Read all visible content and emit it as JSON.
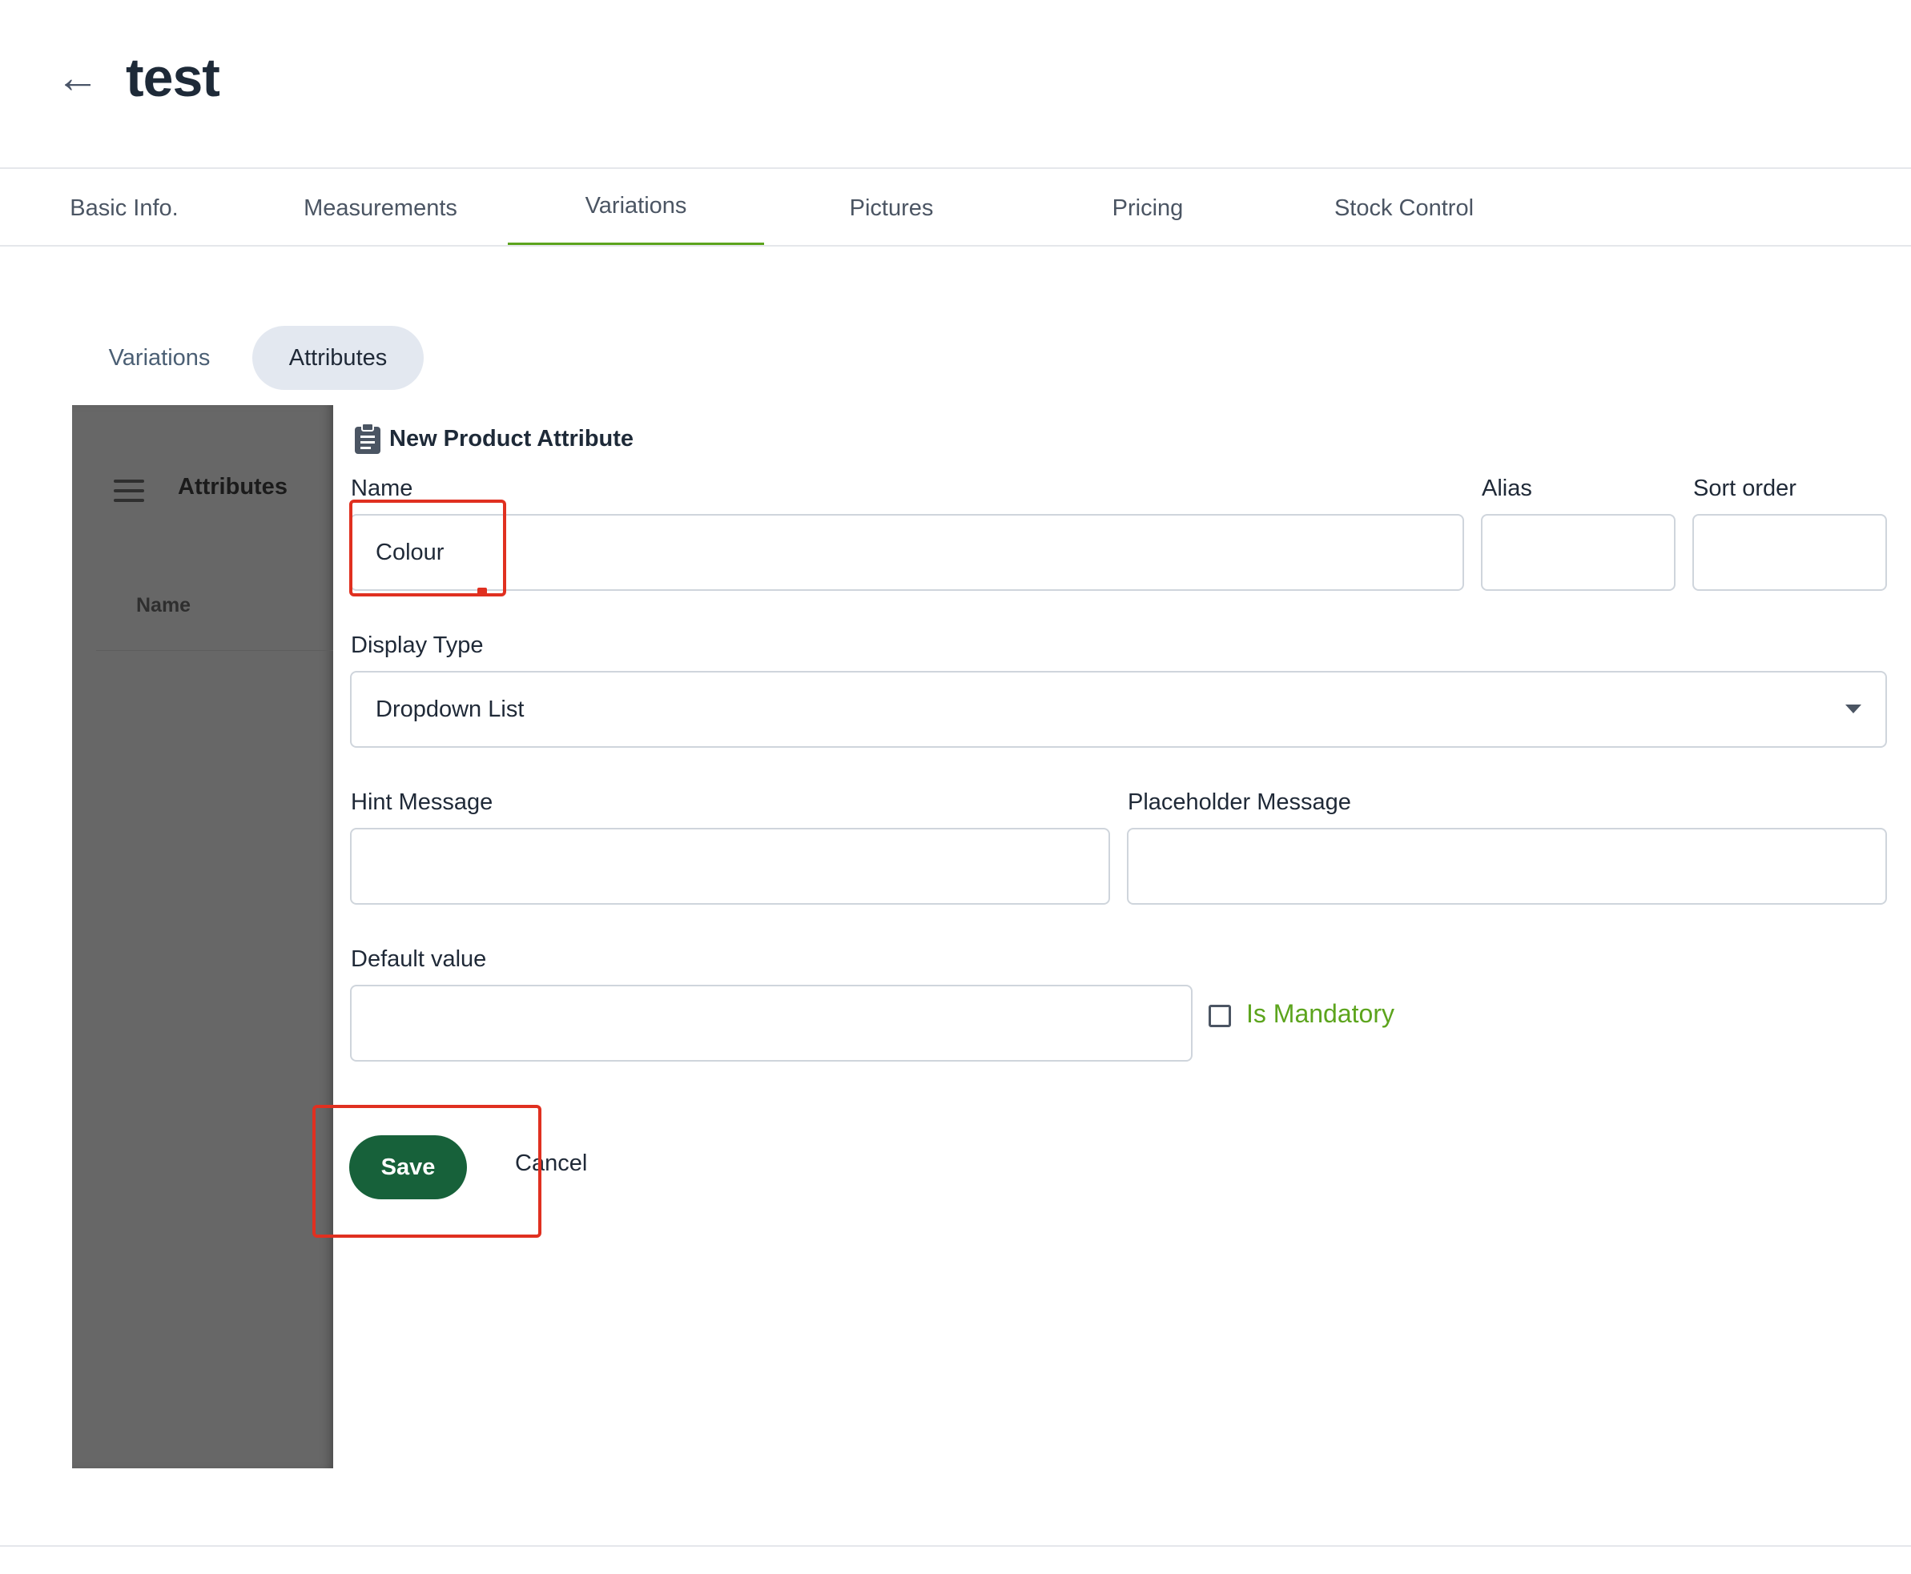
{
  "header": {
    "back_icon": "arrow-left-icon",
    "title": "test"
  },
  "tabs": [
    {
      "label": "Basic Info."
    },
    {
      "label": "Measurements"
    },
    {
      "label": "Variations",
      "active": true
    },
    {
      "label": "Pictures"
    },
    {
      "label": "Pricing"
    },
    {
      "label": "Stock Control"
    }
  ],
  "subtabs": [
    {
      "label": "Variations"
    },
    {
      "label": "Attributes",
      "active": true
    }
  ],
  "side_panel": {
    "title": "Attributes",
    "column_header": "Name",
    "menu_icon": "hamburger-menu-icon"
  },
  "form": {
    "title": "New Product Attribute",
    "title_icon": "clipboard-icon",
    "name": {
      "label": "Name",
      "value": "Colour"
    },
    "alias": {
      "label": "Alias",
      "value": ""
    },
    "sort_order": {
      "label": "Sort order",
      "value": ""
    },
    "display_type": {
      "label": "Display Type",
      "value": "Dropdown List"
    },
    "hint": {
      "label": "Hint Message",
      "value": ""
    },
    "placeholder": {
      "label": "Placeholder Message",
      "value": ""
    },
    "default_value": {
      "label": "Default value",
      "value": ""
    },
    "is_mandatory": {
      "label": "Is Mandatory",
      "checked": false
    },
    "save_label": "Save",
    "cancel_label": "Cancel"
  },
  "colors": {
    "accent": "#5ca41d",
    "primary_button": "#17613a",
    "highlight": "#e03020",
    "overlay": "#676767"
  }
}
